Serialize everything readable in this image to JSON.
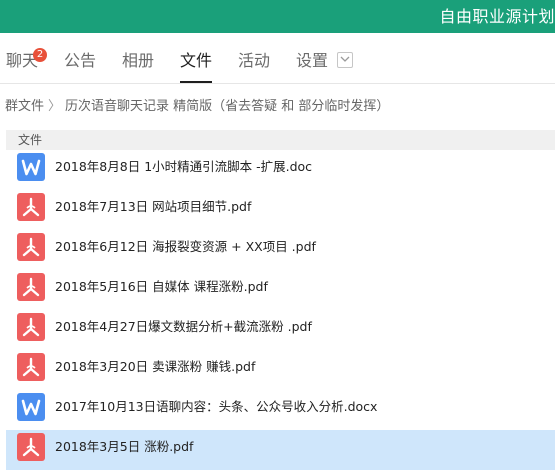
{
  "window": {
    "title": "自由职业源计划"
  },
  "tabs": [
    {
      "label": "聊天",
      "badge": "2",
      "active": false
    },
    {
      "label": "公告",
      "active": false
    },
    {
      "label": "相册",
      "active": false
    },
    {
      "label": "文件",
      "active": true
    },
    {
      "label": "活动",
      "active": false
    },
    {
      "label": "设置",
      "active": false
    }
  ],
  "breadcrumb": {
    "root": "群文件",
    "separator": "〉",
    "current": "历次语音聊天记录 精简版（省去答疑 和 部分临时发挥）"
  },
  "table": {
    "column_file": "文件"
  },
  "files": [
    {
      "name": "2018年8月8日 1小时精通引流脚本 -扩展.doc",
      "type": "word"
    },
    {
      "name": "2018年7月13日 网站项目细节.pdf",
      "type": "pdf"
    },
    {
      "name": "2018年6月12日 海报裂变资源 + XX项目 .pdf",
      "type": "pdf"
    },
    {
      "name": "2018年5月16日 自媒体 课程涨粉.pdf",
      "type": "pdf"
    },
    {
      "name": "2018年4月27日爆文数据分析+截流涨粉 .pdf",
      "type": "pdf"
    },
    {
      "name": "2018年3月20日 卖课涨粉 赚钱.pdf",
      "type": "pdf"
    },
    {
      "name": "2017年10月13日语聊内容：头条、公众号收入分析.docx",
      "type": "word"
    },
    {
      "name": "2018年3月5日 涨粉.pdf",
      "type": "pdf",
      "selected": true
    }
  ],
  "colors": {
    "brand_green": "#1aa07a",
    "word_blue": "#4b8ef0",
    "pdf_red": "#ee5e5e",
    "selection": "#cfe6fb",
    "badge_red": "#e8513a"
  }
}
